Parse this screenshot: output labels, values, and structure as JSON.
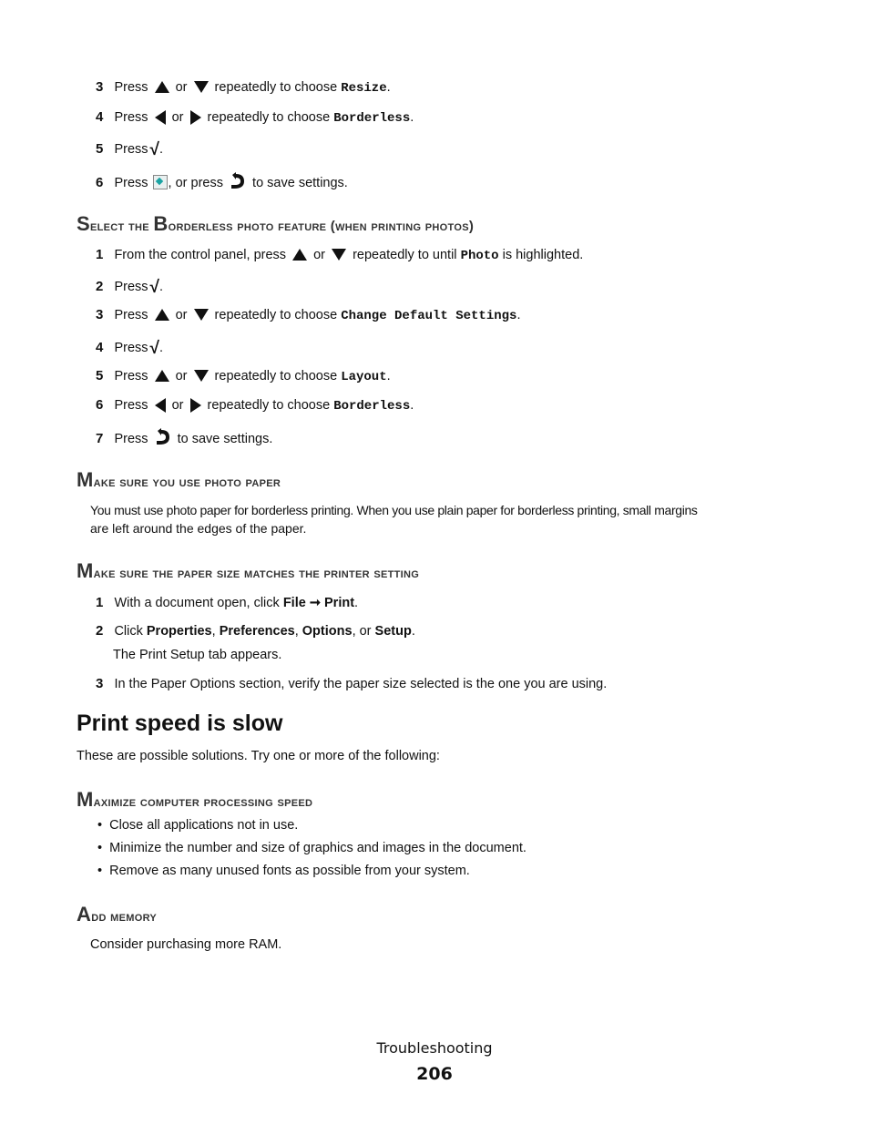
{
  "section1_steps": {
    "s3": {
      "num": "3",
      "pre": "Press",
      "or": "or",
      "post": "repeatedly to choose",
      "value": "Resize",
      "end": "."
    },
    "s4": {
      "num": "4",
      "pre": "Press",
      "or": "or",
      "post": "repeatedly to choose",
      "value": "Borderless",
      "end": "."
    },
    "s5": {
      "num": "5",
      "pre": "Press",
      "end": "."
    },
    "s6": {
      "num": "6",
      "pre": "Press",
      "mid": ", or press",
      "post": "to save settings."
    }
  },
  "heading_borderless": {
    "first": "S",
    "rest": "elect the ",
    "cap2": "B",
    "rest2": "orderless photo feature (when printing photos)"
  },
  "section2_steps": {
    "s1": {
      "num": "1",
      "pre": "From the control panel, press",
      "or": "or",
      "post": "repeatedly to until",
      "value": "Photo",
      "end": "is highlighted."
    },
    "s2": {
      "num": "2",
      "pre": "Press",
      "end": "."
    },
    "s3": {
      "num": "3",
      "pre": "Press",
      "or": "or",
      "post": "repeatedly to choose",
      "value": "Change Default Settings",
      "end": "."
    },
    "s4": {
      "num": "4",
      "pre": "Press",
      "end": "."
    },
    "s5": {
      "num": "5",
      "pre": "Press",
      "or": "or",
      "post": "repeatedly to choose",
      "value": "Layout",
      "end": "."
    },
    "s6": {
      "num": "6",
      "pre": "Press",
      "or": "or",
      "post": "repeatedly to choose",
      "value": "Borderless",
      "end": "."
    },
    "s7": {
      "num": "7",
      "pre": "Press",
      "post": "to save settings."
    }
  },
  "heading_photo_paper": {
    "first": "M",
    "rest": "ake sure you use photo paper"
  },
  "photo_paper_text": {
    "line1": "You must use photo paper for borderless printing. When you use plain paper for borderless printing, small margins",
    "line2": "are left around the edges of the paper."
  },
  "heading_paper_size": {
    "first": "M",
    "rest": "ake sure the paper size matches the printer setting"
  },
  "section3_steps": {
    "s1": {
      "num": "1",
      "pre": "With a document open, click",
      "file": "File",
      "arrow": "➞",
      "print": "Print",
      "end": "."
    },
    "s2": {
      "num": "2",
      "pre": "Click",
      "o1": "Properties",
      "o2": "Preferences",
      "o3": "Options",
      "or": ", or",
      "o4": "Setup",
      "end": ".",
      "note": "The Print Setup tab appears."
    },
    "s3": {
      "num": "3",
      "text": "In the Paper Options section, verify the paper size selected is the one you are using."
    }
  },
  "main_title": "Print speed is slow",
  "intro": "These are possible solutions. Try one or more of the following:",
  "heading_maximize": {
    "first": "M",
    "rest": "aximize computer processing speed"
  },
  "bullets": [
    "Close all applications not in use.",
    "Minimize the number and size of graphics and images in the document.",
    "Remove as many unused fonts as possible from your system."
  ],
  "heading_memory": {
    "first": "A",
    "rest": "dd memory"
  },
  "memory_text": "Consider purchasing more RAM.",
  "footer": {
    "section": "Troubleshooting",
    "page": "206"
  }
}
